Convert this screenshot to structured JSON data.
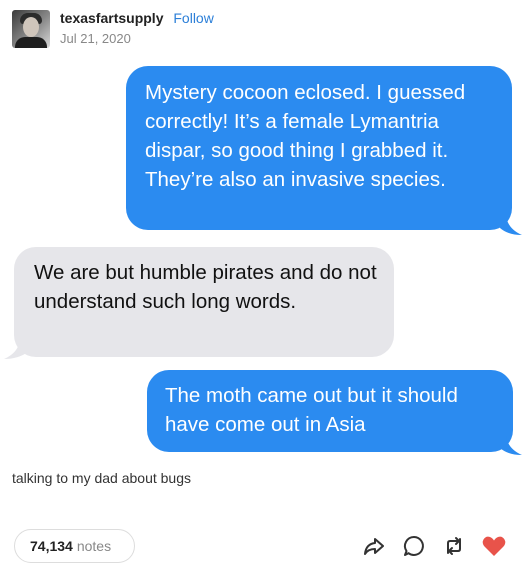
{
  "post": {
    "username": "texasfartsupply",
    "follow_label": "Follow",
    "date": "Jul 21, 2020",
    "caption": "talking to my dad about bugs"
  },
  "messages": [
    {
      "side": "sent",
      "text": "Mystery cocoon eclosed. I guessed correctly! It’s a female Lymantria dispar, so good thing I grabbed it. They’re also an invasive species."
    },
    {
      "side": "received",
      "text": "We are but humble pirates and do not understand such long words."
    },
    {
      "side": "sent",
      "text": "The moth came out but it should have come out in Asia"
    }
  ],
  "footer": {
    "notes_count": "74,134",
    "notes_label": "notes",
    "icons": [
      "share-icon",
      "reply-icon",
      "reblog-icon",
      "like-icon"
    ]
  },
  "colors": {
    "sent_bubble": "#2b8bf0",
    "received_bubble": "#e6e6ea",
    "follow_link": "#2c7fd8",
    "like_heart": "#e8534a"
  }
}
